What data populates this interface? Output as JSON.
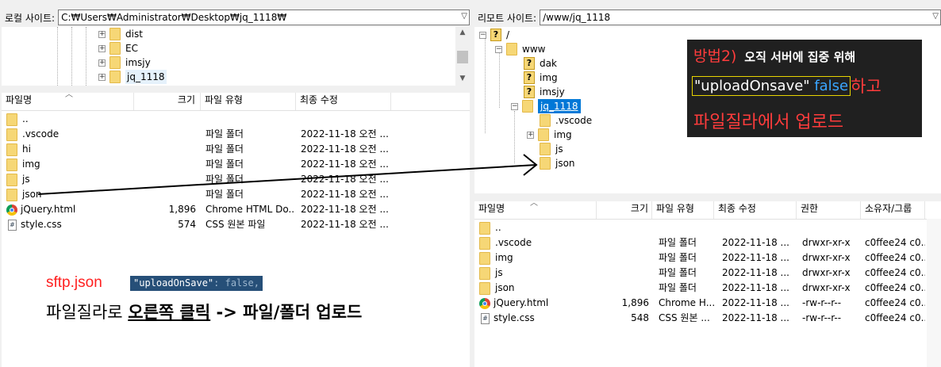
{
  "local": {
    "site_label": "로컬 사이트:",
    "site_path": "C:₩Users₩Administrator₩Desktop₩jq_1118₩",
    "tree": [
      "dist",
      "EC",
      "imsjy",
      "jq_1118"
    ],
    "headers": [
      "파일명",
      "크기",
      "파일 유형",
      "최종 수정"
    ],
    "rows": [
      {
        "name": "..",
        "size": "",
        "type": "",
        "modified": "",
        "icon": "folder-icon"
      },
      {
        "name": ".vscode",
        "size": "",
        "type": "파일 폴더",
        "modified": "2022-11-18 오전 ...",
        "icon": "folder-icon"
      },
      {
        "name": "hi",
        "size": "",
        "type": "파일 폴더",
        "modified": "2022-11-18 오전 ...",
        "icon": "folder-icon"
      },
      {
        "name": "img",
        "size": "",
        "type": "파일 폴더",
        "modified": "2022-11-18 오전 ...",
        "icon": "folder-icon"
      },
      {
        "name": "js",
        "size": "",
        "type": "파일 폴더",
        "modified": "2022-11-18 오전 ...",
        "icon": "folder-icon"
      },
      {
        "name": "json",
        "size": "",
        "type": "파일 폴더",
        "modified": "2022-11-18 오전 ...",
        "icon": "folder-icon"
      },
      {
        "name": "jQuery.html",
        "size": "1,896",
        "type": "Chrome HTML Do...",
        "modified": "2022-11-18 오전 ...",
        "icon": "chrome-icon"
      },
      {
        "name": "style.css",
        "size": "574",
        "type": "CSS 원본 파일",
        "modified": "2022-11-18 오전 ...",
        "icon": "css-file-icon"
      }
    ]
  },
  "remote": {
    "site_label": "리모트 사이트:",
    "site_path": "/www/jq_1118",
    "tree": [
      "/",
      "www",
      "dak",
      "img",
      "imsjy",
      "jq_1118",
      ".vscode",
      "img",
      "js",
      "json"
    ],
    "headers": [
      "파일명",
      "크기",
      "파일 유형",
      "최종 수정",
      "권한",
      "소유자/그룹"
    ],
    "rows": [
      {
        "name": "..",
        "size": "",
        "type": "",
        "modified": "",
        "perm": "",
        "owner": "",
        "icon": "folder-icon"
      },
      {
        "name": ".vscode",
        "size": "",
        "type": "파일 폴더",
        "modified": "2022-11-18 ...",
        "perm": "drwxr-xr-x",
        "owner": "c0ffee24 c0...",
        "icon": "folder-icon"
      },
      {
        "name": "img",
        "size": "",
        "type": "파일 폴더",
        "modified": "2022-11-18 ...",
        "perm": "drwxr-xr-x",
        "owner": "c0ffee24 c0...",
        "icon": "folder-icon"
      },
      {
        "name": "js",
        "size": "",
        "type": "파일 폴더",
        "modified": "2022-11-18 ...",
        "perm": "drwxr-xr-x",
        "owner": "c0ffee24 c0...",
        "icon": "folder-icon"
      },
      {
        "name": "json",
        "size": "",
        "type": "파일 폴더",
        "modified": "2022-11-18 ...",
        "perm": "drwxr-xr-x",
        "owner": "c0ffee24 c0...",
        "icon": "folder-icon"
      },
      {
        "name": "jQuery.html",
        "size": "1,896",
        "type": "Chrome H...",
        "modified": "2022-11-18 ...",
        "perm": "-rw-r--r--",
        "owner": "c0ffee24 c0...",
        "icon": "chrome-icon"
      },
      {
        "name": "style.css",
        "size": "548",
        "type": "CSS 원본 ...",
        "modified": "2022-11-18 ...",
        "perm": "-rw-r--r--",
        "owner": "c0ffee24 c0...",
        "icon": "css-file-icon"
      }
    ]
  },
  "annotation_right": {
    "method": "방법2)",
    "method_desc": "오직 서버에 집중 위해",
    "setting_key": "\"uploadOnsave\"",
    "setting_val": "false",
    "line1_suffix": "하고",
    "line2": "파일질라에서 업로드"
  },
  "annotation_left": {
    "file": "sftp.json",
    "code_key": "\"uploadOnSave\"",
    "code_rest": ": false,",
    "instr_pre": "파일질라로 ",
    "instr_underlined": "오른쪽 클릭",
    "instr_post": " -> 파일/폴더 업로드"
  },
  "colors": {
    "annot_red": "#ff3c3c",
    "annot_bg": "#202020",
    "selected": "#0078d7",
    "code_bg": "#264f78"
  }
}
